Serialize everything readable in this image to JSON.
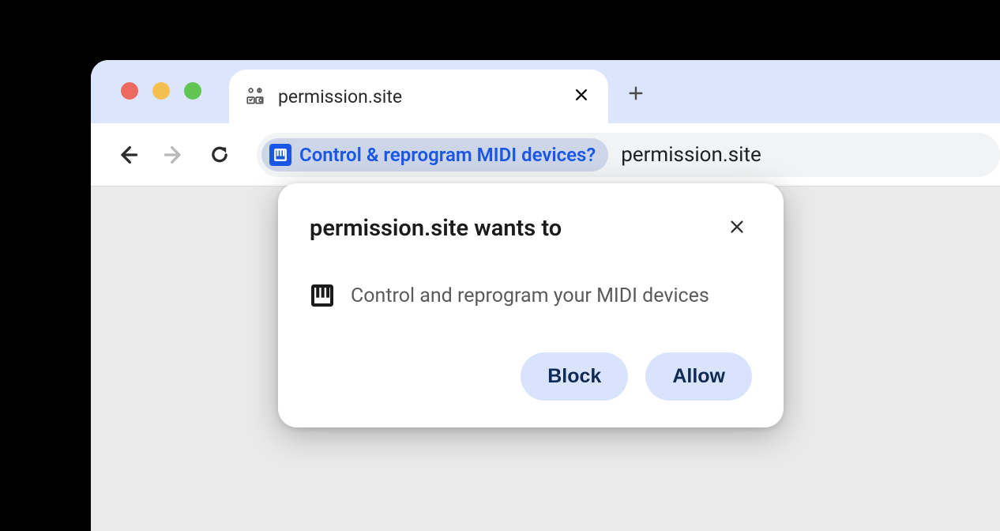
{
  "tab": {
    "title": "permission.site"
  },
  "omnibox": {
    "chip_label": "Control & reprogram MIDI devices?",
    "url": "permission.site"
  },
  "dialog": {
    "title": "permission.site wants to",
    "permission_text": "Control and reprogram your MIDI devices",
    "block_label": "Block",
    "allow_label": "Allow"
  }
}
